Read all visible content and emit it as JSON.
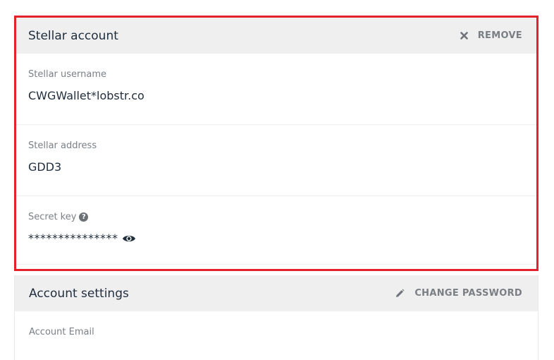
{
  "stellar_panel": {
    "title": "Stellar account",
    "remove_label": "REMOVE",
    "fields": [
      {
        "label": "Stellar username",
        "value": "CWGWallet*lobstr.co"
      },
      {
        "label": "Stellar address",
        "value": "GDD3"
      },
      {
        "label": "Secret key",
        "value": "***************"
      }
    ]
  },
  "settings_panel": {
    "title": "Account settings",
    "change_password_label": "CHANGE PASSWORD",
    "email_label": "Account Email"
  },
  "colors": {
    "highlight_border": "#e3222b",
    "header_bg": "#efefef",
    "muted_text": "#7a8087"
  },
  "icons": {
    "remove": "close-icon",
    "help": "question-circle-icon",
    "reveal": "eye-icon",
    "edit": "pencil-icon"
  }
}
